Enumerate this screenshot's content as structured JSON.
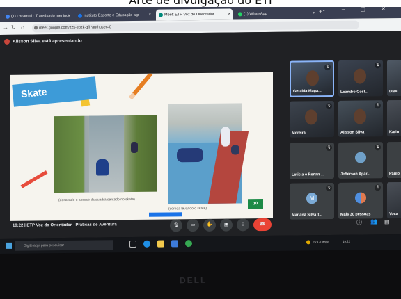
{
  "caption": {
    "text": "Arte de divulgação do ETI"
  },
  "browser": {
    "tabs": [
      {
        "label": "(1) Locamail : Transbordo meninos",
        "color": "#4285f4"
      },
      {
        "label": "Instituto Esporte e Educação agr",
        "color": "#1a73e8"
      },
      {
        "label": "Meet: ETP Voz do Orientador",
        "color": "#00897b"
      },
      {
        "label": "(1) WhatsApp",
        "color": "#25d366"
      }
    ],
    "url": "meet.google.com/zzs-eozk-gfi?authuser=0",
    "tab_close": "×",
    "new_tab": "+"
  },
  "meet": {
    "presenter_text": "Alisson Silva está apresentando",
    "meeting_info": "19:22  |  ETP Voz do Orientador - Práticas de Aventura"
  },
  "slide": {
    "title": "Skate",
    "caption_left": "(descendo o acesso da quadra sentado no skate)",
    "caption_right": "(corrida levando o skate)",
    "page_number": "10"
  },
  "participants": [
    {
      "name": "Geralda Maga...",
      "type": "cam",
      "highlight": true
    },
    {
      "name": "Leandro Cost...",
      "type": "cam",
      "highlight": false
    },
    {
      "name": "Dals",
      "type": "cam",
      "highlight": false
    },
    {
      "name": "Moreira",
      "type": "cam",
      "highlight": false
    },
    {
      "name": "Alisson Silva",
      "type": "cam",
      "highlight": false
    },
    {
      "name": "Karin",
      "type": "cam",
      "highlight": false
    },
    {
      "name": "Leticia e Renan ...",
      "type": "plain",
      "highlight": false
    },
    {
      "name": "Jefferson Apar...",
      "type": "avatar",
      "highlight": false
    },
    {
      "name": "Paulo",
      "type": "plain",
      "highlight": false
    },
    {
      "name": "Mariana Silva T...",
      "type": "letter",
      "letter": "M",
      "highlight": false
    },
    {
      "name": "Mais 30 pessoas",
      "type": "group",
      "highlight": false
    },
    {
      "name": "Voca",
      "type": "cam",
      "highlight": false
    }
  ],
  "taskbar": {
    "search_placeholder": "Digite aqui para pesquisar",
    "tray_text": "25°C  Limpo",
    "tray_time": "19:22"
  },
  "bezel_logo": "DELL"
}
